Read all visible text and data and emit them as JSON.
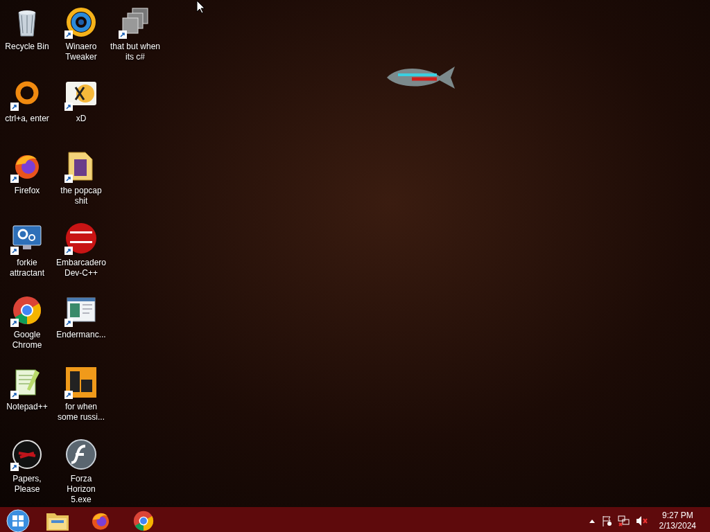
{
  "desktop_icons": [
    {
      "label": "Recycle Bin",
      "kind": "bin",
      "shortcut": false
    },
    {
      "label": "ctrl+a, enter",
      "kind": "ring",
      "shortcut": true
    },
    {
      "label": "Firefox",
      "kind": "firefox",
      "shortcut": true
    },
    {
      "label": "forkie attractant",
      "kind": "monitor",
      "shortcut": true
    },
    {
      "label": "Google Chrome",
      "kind": "chrome",
      "shortcut": true
    },
    {
      "label": "Notepad++",
      "kind": "notepad",
      "shortcut": true
    },
    {
      "label": "Papers, Please",
      "kind": "seal",
      "shortcut": true
    },
    {
      "label": "Winaero Tweaker",
      "kind": "swirl",
      "shortcut": true
    },
    {
      "label": "xD",
      "kind": "hxd",
      "shortcut": true
    },
    {
      "label": "the popcap shit",
      "kind": "folder",
      "shortcut": true
    },
    {
      "label": "Embarcadero Dev-C++",
      "kind": "dev",
      "shortcut": true
    },
    {
      "label": "Endermanc...",
      "kind": "window",
      "shortcut": true
    },
    {
      "label": "for when some russi...",
      "kind": "de",
      "shortcut": true
    },
    {
      "label": "Forza Horizon 5.exe",
      "kind": "flash",
      "shortcut": false
    },
    {
      "label": "that but when its c#",
      "kind": "stack",
      "shortcut": true
    }
  ],
  "taskbar": {
    "pinned": [
      {
        "kind": "explorer"
      },
      {
        "kind": "firefox"
      },
      {
        "kind": "chrome"
      }
    ],
    "tray": {
      "time": "9:27 PM",
      "date": "2/13/2024",
      "volume_muted": true,
      "network_error": true
    }
  }
}
